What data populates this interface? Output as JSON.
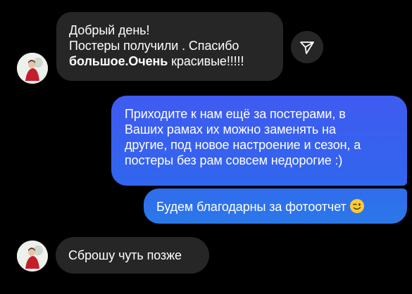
{
  "messages": {
    "incoming_1": {
      "line1": "Добрый день!",
      "line2": "Постеры получили . Спасибо",
      "line3_bold": "большое.Очень",
      "line3_rest": " красивые!!!!!"
    },
    "outgoing_1": {
      "line1": "Приходите к нам ещё за постерами, в",
      "line2": "Ваших рамах их можно заменять на",
      "line3": "другие, под новое настроение и сезон, а",
      "line4": "постеры без рам совсем недорогие :)"
    },
    "outgoing_2": {
      "text": "Будем благодарны за фотоотчет",
      "emoji": "winking-face"
    },
    "incoming_2": {
      "text": "Сброшу чуть позже"
    }
  },
  "icons": {
    "share": "paper-plane-icon",
    "avatar": "contact-avatar"
  },
  "colors": {
    "background": "#000000",
    "incoming_bubble": "#262626",
    "outgoing_gradient_top": "#3f5bf0",
    "outgoing_gradient_bottom": "#2b76e8",
    "text": "#ffffff"
  }
}
